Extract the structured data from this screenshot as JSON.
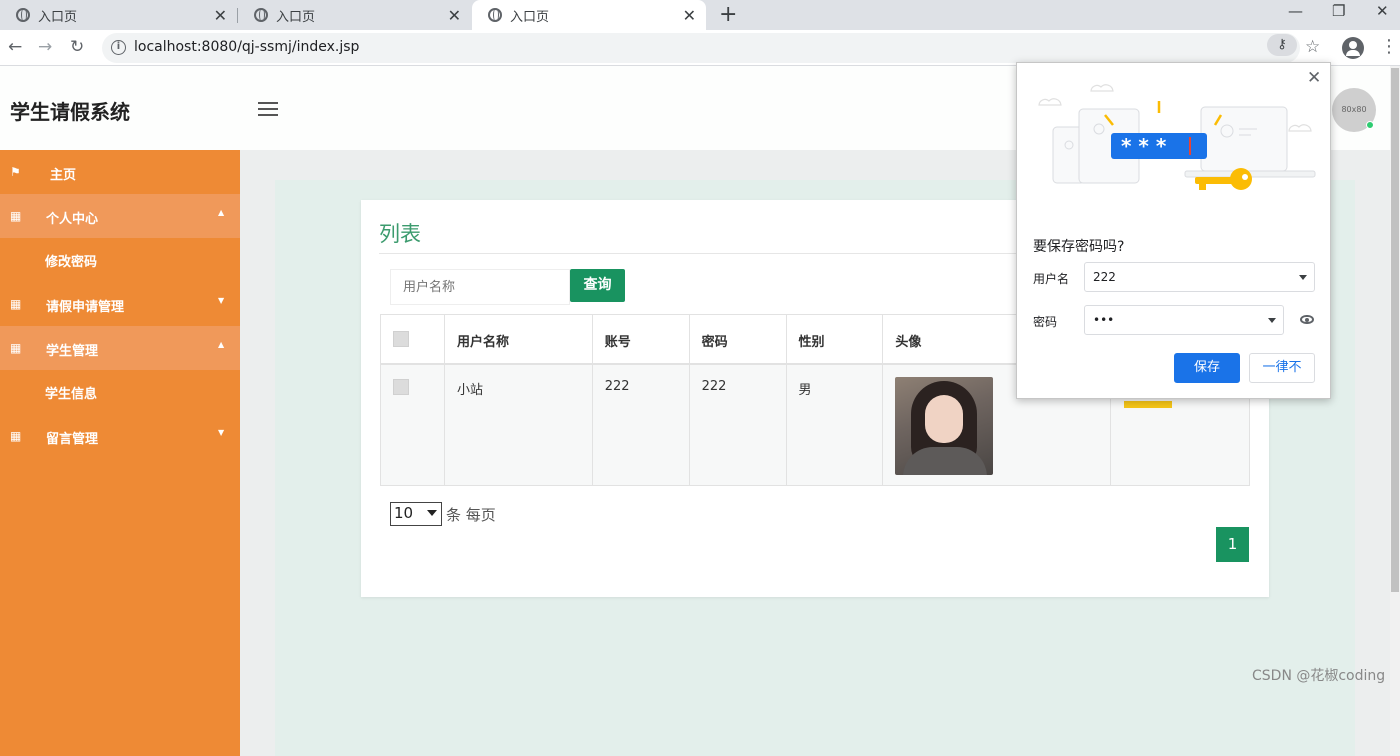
{
  "browser": {
    "tabs": [
      {
        "title": "入口页",
        "active": false
      },
      {
        "title": "入口页",
        "active": false
      },
      {
        "title": "入口页",
        "active": true
      }
    ],
    "url": "localhost:8080/qj-ssmj/index.jsp"
  },
  "header": {
    "brand": "学生请假系统",
    "avatar_text": "80x80"
  },
  "sidebar": {
    "items": [
      {
        "label": "主页",
        "icon": "flag-icon"
      },
      {
        "label": "个人中心",
        "icon": "grid-icon",
        "expanded": true
      },
      {
        "label": "修改密码",
        "sub": true
      },
      {
        "label": "请假申请管理",
        "icon": "grid-icon",
        "expanded": false
      },
      {
        "label": "学生管理",
        "icon": "grid-icon",
        "expanded": true
      },
      {
        "label": "学生信息",
        "sub": true
      },
      {
        "label": "留言管理",
        "icon": "grid-icon",
        "expanded": false
      }
    ]
  },
  "main": {
    "title": "列表",
    "search_placeholder": "用户名称",
    "search_button": "查询",
    "table": {
      "headers": [
        "用户名称",
        "账号",
        "密码",
        "性别",
        "头像"
      ],
      "rows": [
        {
          "name": "小站",
          "account": "222",
          "password": "222",
          "gender": "男"
        }
      ]
    },
    "page_size": "10",
    "per_page_label": "条 每页",
    "current_page": "1"
  },
  "password_bubble": {
    "title": "要保存密码吗?",
    "username_label": "用户名",
    "username_value": "222",
    "password_label": "密码",
    "password_value": "•••",
    "save_button": "保存",
    "never_button": "一律不"
  },
  "watermark": "CSDN @花椒coding",
  "colors": {
    "sidebar": "#ee8a35",
    "accent_green": "#199360",
    "chrome_blue": "#1a73e8"
  }
}
